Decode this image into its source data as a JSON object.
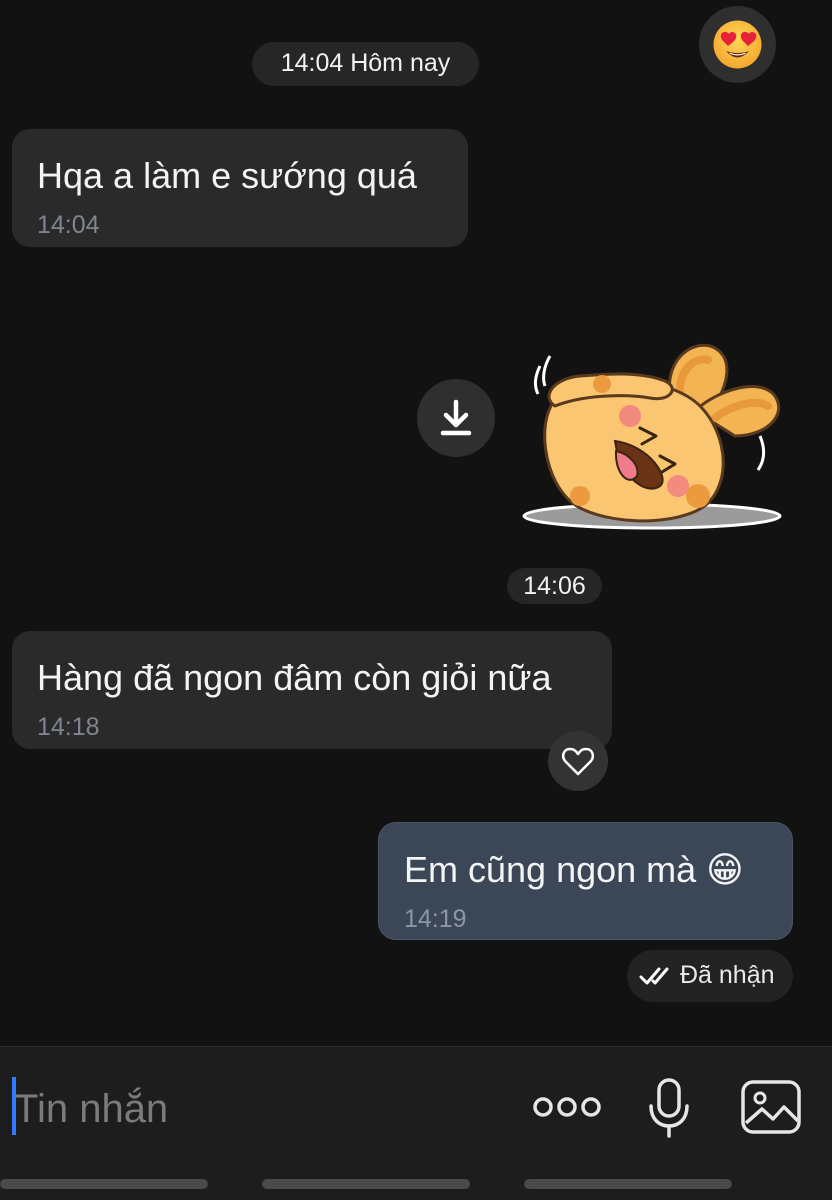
{
  "chat": {
    "date_divider": "14:04 Hôm nay",
    "top_reaction": "heart-eyes-emoji",
    "messages": [
      {
        "direction": "in",
        "text": "Hqa a làm e sướng quá",
        "time": "14:04"
      },
      {
        "direction": "in",
        "type": "sticker",
        "sticker": "laughing-bunny-sticker",
        "time": "14:06"
      },
      {
        "direction": "in",
        "text": "Hàng đã ngon đâm còn giỏi nữa",
        "time": "14:18"
      },
      {
        "direction": "out",
        "text": "Em cũng ngon mà 😁",
        "time": "14:19",
        "status": "Đã nhận"
      }
    ]
  },
  "composer": {
    "placeholder": "Tin nhắn",
    "icons": [
      "more-icon",
      "microphone-icon",
      "image-icon"
    ]
  },
  "colors": {
    "background": "#121212",
    "incoming_bubble": "#2a2a2a",
    "outgoing_bubble": "#3b4757",
    "cursor": "#2f7cff"
  }
}
